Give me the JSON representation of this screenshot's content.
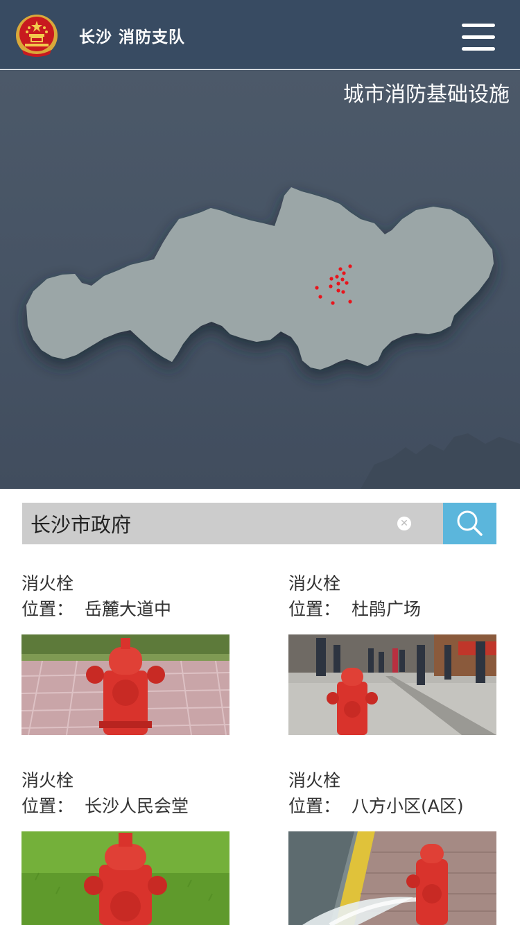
{
  "header": {
    "title": "长沙 消防支队",
    "emblem_icon": "national-emblem-icon",
    "menu_icon": "hamburger-menu-icon"
  },
  "map": {
    "title": "城市消防基础设施",
    "marker_color": "#e8141c",
    "region_color": "#9ba6a7"
  },
  "search": {
    "value": "长沙市政府",
    "clear_icon": "clear-icon",
    "search_icon": "search-icon"
  },
  "results": [
    {
      "type": "消火栓",
      "location_label": "位置：",
      "location": "岳麓大道中",
      "photo": "hydrant-on-brick-pavement"
    },
    {
      "type": "消火栓",
      "location_label": "位置：",
      "location": "杜鹃广场",
      "photo": "hydrant-on-pedestrian-street"
    },
    {
      "type": "消火栓",
      "location_label": "位置：",
      "location": "长沙人民会堂",
      "photo": "hydrant-on-grass"
    },
    {
      "type": "消火栓",
      "location_label": "位置：",
      "location": "八方小区(A区)",
      "photo": "hydrant-spraying-water"
    }
  ],
  "colors": {
    "header_bg": "#384b62",
    "map_bg": "#465364",
    "search_button": "#5bb6dc",
    "search_field": "#cccccc"
  }
}
